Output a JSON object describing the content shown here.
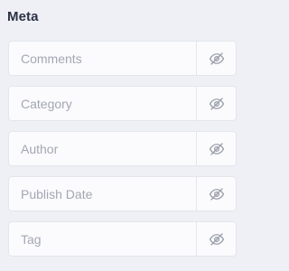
{
  "section": {
    "title": "Meta"
  },
  "items": [
    {
      "label": "Comments",
      "visibility_icon": "eye-off-icon"
    },
    {
      "label": "Category",
      "visibility_icon": "eye-off-icon"
    },
    {
      "label": "Author",
      "visibility_icon": "eye-off-icon"
    },
    {
      "label": "Publish Date",
      "visibility_icon": "eye-off-icon"
    },
    {
      "label": "Tag",
      "visibility_icon": "eye-off-icon"
    }
  ],
  "colors": {
    "background": "#eef0f5",
    "row_background": "#fbfbfd",
    "border": "#e4e6ec",
    "title_text": "#2d3147",
    "label_text": "#a3a7b3",
    "icon": "#9aa0ab"
  }
}
